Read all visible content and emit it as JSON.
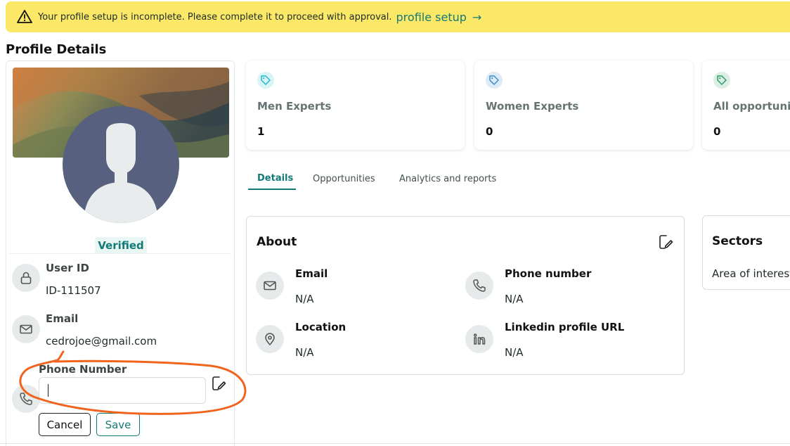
{
  "alert": {
    "message": "Your profile setup is incomplete. Please complete it to proceed with approval.",
    "link_label": "profile setup",
    "arrow": "→",
    "icon": "warning-icon",
    "background": "#fbe866"
  },
  "page_title": "Profile Details",
  "profile": {
    "verified_label": "Verified",
    "user_id_label": "User ID",
    "user_id_value": "ID-111507",
    "email_label": "Email",
    "email_value": "cedrojoe@gmail.com",
    "phone_label": "Phone Number",
    "phone_value": "",
    "cancel_label": "Cancel",
    "save_label": "Save"
  },
  "stats": [
    {
      "label": "Men Experts",
      "value": "1",
      "icon": "tag-icon",
      "icon_color": "#26b8c9"
    },
    {
      "label": "Women Experts",
      "value": "0",
      "icon": "tag-icon",
      "icon_color": "#3d8ec8"
    },
    {
      "label": "All opportunities",
      "value": "0",
      "icon": "tag-icon",
      "icon_color": "#2f9c6a"
    }
  ],
  "tabs": [
    {
      "label": "Details",
      "active": true
    },
    {
      "label": "Opportunities",
      "active": false
    },
    {
      "label": "Analytics and reports",
      "active": false
    }
  ],
  "about": {
    "title": "About",
    "email_label": "Email",
    "email_value": "N/A",
    "phone_label": "Phone number",
    "phone_value": "N/A",
    "location_label": "Location",
    "location_value": "N/A",
    "linkedin_label": "Linkedin profile URL",
    "linkedin_value": "N/A"
  },
  "sectors": {
    "title": "Sectors",
    "subtitle": "Area of interest"
  },
  "colors": {
    "accent": "#137a78",
    "annotation": "#f0641e"
  }
}
